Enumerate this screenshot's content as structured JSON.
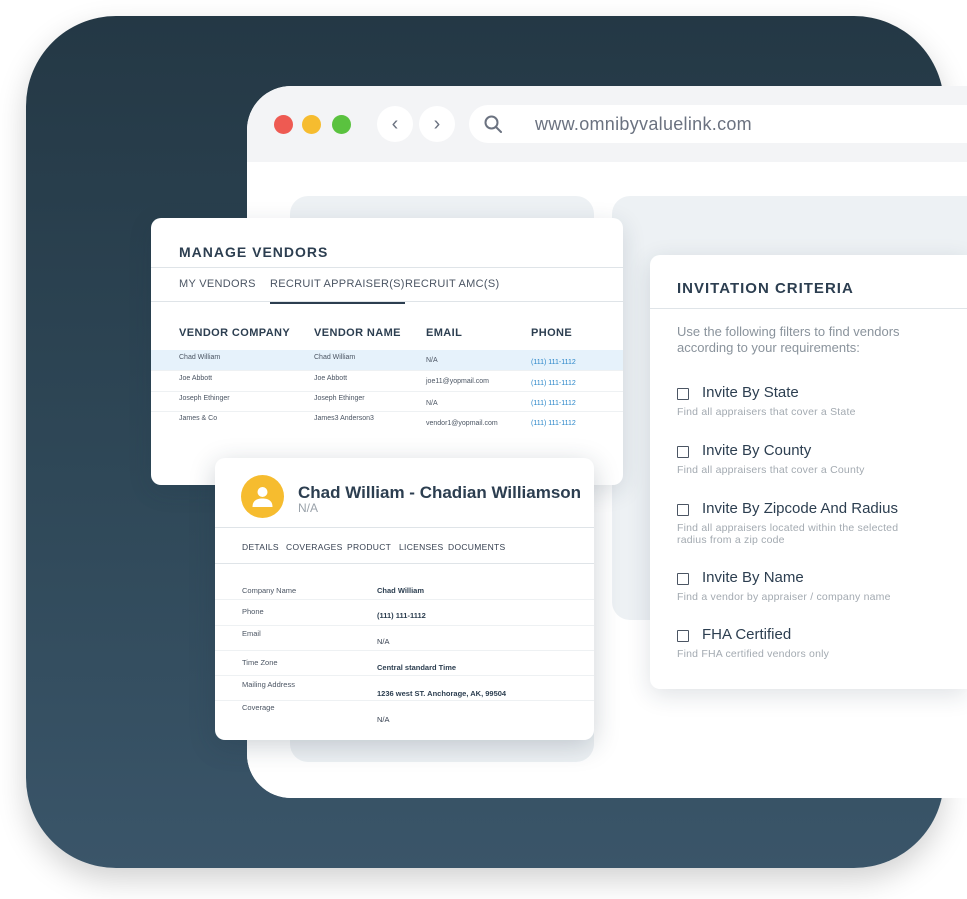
{
  "browser": {
    "url": "www.omnibyvaluelink.com",
    "controls": {
      "back": "‹",
      "forward": "›"
    }
  },
  "manage_vendors": {
    "title": "MANAGE VENDORS",
    "tabs": [
      "MY VENDORS",
      "RECRUIT APPRAISER(S)",
      "RECRUIT AMC(S)"
    ],
    "active_tab": "RECRUIT APPRAISER(S)",
    "columns": [
      "VENDOR COMPANY",
      "VENDOR NAME",
      "EMAIL",
      "PHONE"
    ],
    "rows": [
      {
        "company": "Chad William",
        "name": "Chad William",
        "email": "N/A",
        "phone": "(111) 111-1112"
      },
      {
        "company": "Joe Abbott",
        "name": "Joe Abbott",
        "email": "joe11@yopmail.com",
        "phone": "(111) 111-1112"
      },
      {
        "company": "Joseph Ethinger",
        "name": "Joseph Ethinger",
        "email": "N/A",
        "phone": "(111) 111-1112"
      },
      {
        "company": "James & Co",
        "name": "James3 Anderson3",
        "email": "vendor1@yopmail.com",
        "phone": "(111) 111-1112"
      }
    ]
  },
  "invitation_criteria": {
    "title": "INVITATION CRITERIA",
    "description": "Use the following filters to find vendors according to your requirements:",
    "items": [
      {
        "label": "Invite By State",
        "sub": "Find all appraisers that cover a State"
      },
      {
        "label": "Invite By County",
        "sub": "Find all appraisers that cover a County"
      },
      {
        "label": "Invite By Zipcode And Radius",
        "sub": "Find all appraisers located within the selected radius from a zip code"
      },
      {
        "label": "Invite By Name",
        "sub": "Find a vendor by appraiser / company name"
      },
      {
        "label": "FHA Certified",
        "sub": "Find FHA certified vendors only"
      }
    ]
  },
  "vendor_detail": {
    "name": "Chad William - Chadian Williamson",
    "subtitle": "N/A",
    "tabs": [
      "DETAILS",
      "COVERAGES",
      "PRODUCT",
      "LICENSES",
      "DOCUMENTS"
    ],
    "active_tab": "DETAILS",
    "fields": [
      {
        "label": "Company Name",
        "value": "Chad William"
      },
      {
        "label": "Phone",
        "value": "(111) 111-1112"
      },
      {
        "label": "Email",
        "value": "N/A"
      },
      {
        "label": "Time Zone",
        "value": "Central standard Time"
      },
      {
        "label": "Mailing Address",
        "value": "1236 west ST. Anchorage, AK, 99504"
      },
      {
        "label": "Coverage",
        "value": "N/A"
      }
    ]
  },
  "colors": {
    "background_top": "#243845",
    "background_bottom": "#3a5569",
    "avatar": "#f6bc2f",
    "link_phone": "#2a86c9",
    "selected_row": "#e6f2fb"
  }
}
